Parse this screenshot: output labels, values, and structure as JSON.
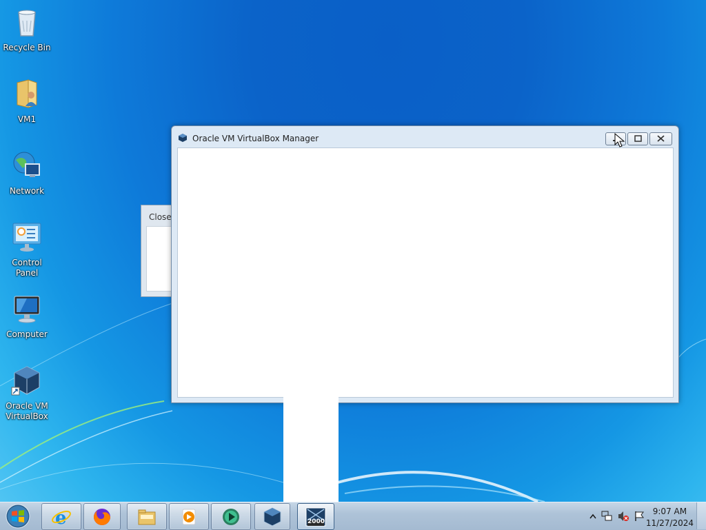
{
  "desktop_icons": [
    {
      "label": "Recycle Bin",
      "icon": "recycle-bin-icon"
    },
    {
      "label": "VM1",
      "icon": "user-folder-icon"
    },
    {
      "label": "Network",
      "icon": "network-icon"
    },
    {
      "label": "Control Panel",
      "icon": "control-panel-icon"
    },
    {
      "label": "Computer",
      "icon": "computer-icon"
    },
    {
      "label": "Oracle VM VirtualBox",
      "icon": "virtualbox-shortcut-icon"
    }
  ],
  "background_dialog": {
    "title": "Close"
  },
  "window": {
    "title": "Oracle VM VirtualBox Manager",
    "icon": "virtualbox-icon",
    "buttons": [
      "minimize",
      "maximize",
      "close"
    ]
  },
  "taskbar": {
    "start_icon": "windows-start-orb-icon",
    "pinned": [
      {
        "name": "internet-explorer-icon"
      },
      {
        "name": "firefox-icon"
      },
      {
        "name": "file-explorer-icon"
      },
      {
        "name": "media-player-icon"
      },
      {
        "name": "media-center-icon"
      },
      {
        "name": "virtualbox-icon"
      },
      {
        "name": "windows-2000-vm-icon",
        "badge": "2000"
      }
    ],
    "tray": {
      "icons": [
        "show-hidden-icons",
        "network-status-icon",
        "volume-muted-icon",
        "action-center-flag-icon"
      ],
      "time": "9:07 AM",
      "date": "11/27/2024"
    }
  },
  "colors": {
    "accent": "#0b63c9",
    "taskbar": "#aec3d8",
    "window_frame": "#dde9f5"
  }
}
